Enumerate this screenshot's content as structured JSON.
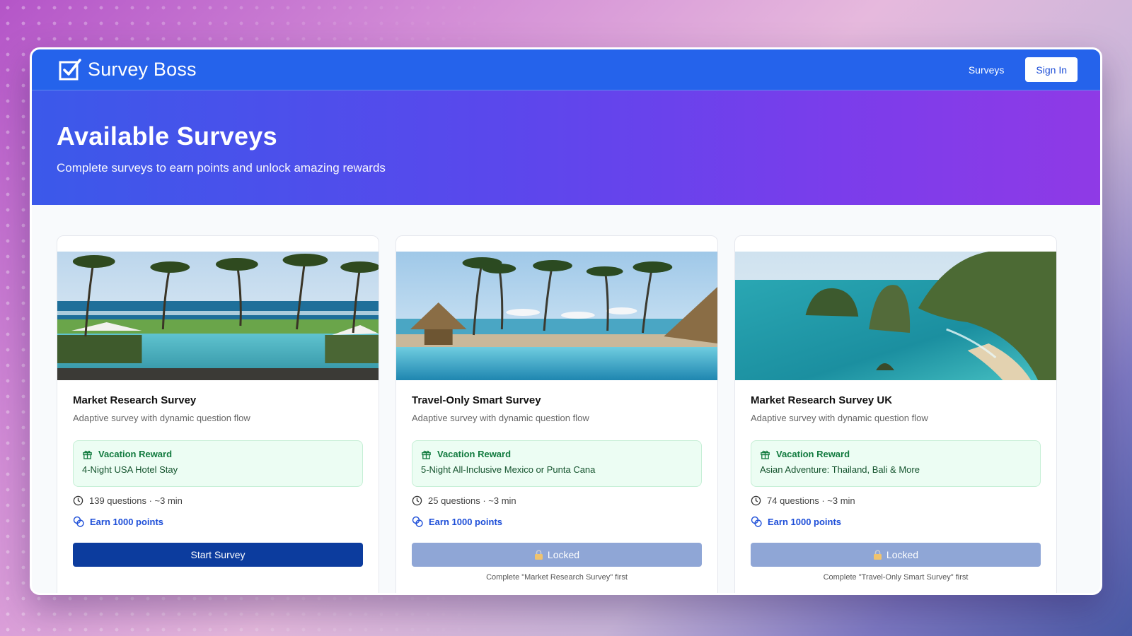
{
  "nav": {
    "brand": "Survey Boss",
    "links": [
      "Surveys"
    ],
    "signin_label": "Sign In"
  },
  "hero": {
    "title": "Available Surveys",
    "subtitle": "Complete surveys to earn points and unlock amazing rewards"
  },
  "cards": [
    {
      "title": "Market Research Survey",
      "description": "Adaptive survey with dynamic question flow",
      "reward_label": "Vacation Reward",
      "reward": "4-Night USA Hotel Stay",
      "meta": "139 questions · ~3 min",
      "points": "Earn 1000 points",
      "button": "Start Survey",
      "locked": false,
      "image": "resort-pool-palms-ocean"
    },
    {
      "title": "Travel-Only Smart Survey",
      "description": "Adaptive survey with dynamic question flow",
      "reward_label": "Vacation Reward",
      "reward": "5-Night All-Inclusive Mexico or Punta Cana",
      "meta": "25 questions · ~3 min",
      "points": "Earn 1000 points",
      "button": "Locked",
      "locked": true,
      "lock_note": "Complete \"Market Research Survey\" first",
      "image": "beach-resort-infinity-pool"
    },
    {
      "title": "Market Research Survey UK",
      "description": "Adaptive survey with dynamic question flow",
      "reward_label": "Vacation Reward",
      "reward": "Asian Adventure: Thailand, Bali & More",
      "meta": "74 questions · ~3 min",
      "points": "Earn 1000 points",
      "button": "Locked",
      "locked": true,
      "lock_note": "Complete \"Travel-Only Smart Survey\" first",
      "image": "tropical-cliffs-turquoise-bay"
    }
  ],
  "icons": {
    "brand": "checkbox-icon",
    "reward": "gift-icon",
    "time": "clock-icon",
    "points": "coins-icon",
    "lock": "lock-icon"
  },
  "colors": {
    "navbar": "#2563eb",
    "primary_button": "#0c3c9e",
    "locked_button": "#8fa6d6",
    "reward_bg": "#ecfdf3",
    "reward_text": "#117a3e",
    "points_text": "#1d4ed8"
  }
}
